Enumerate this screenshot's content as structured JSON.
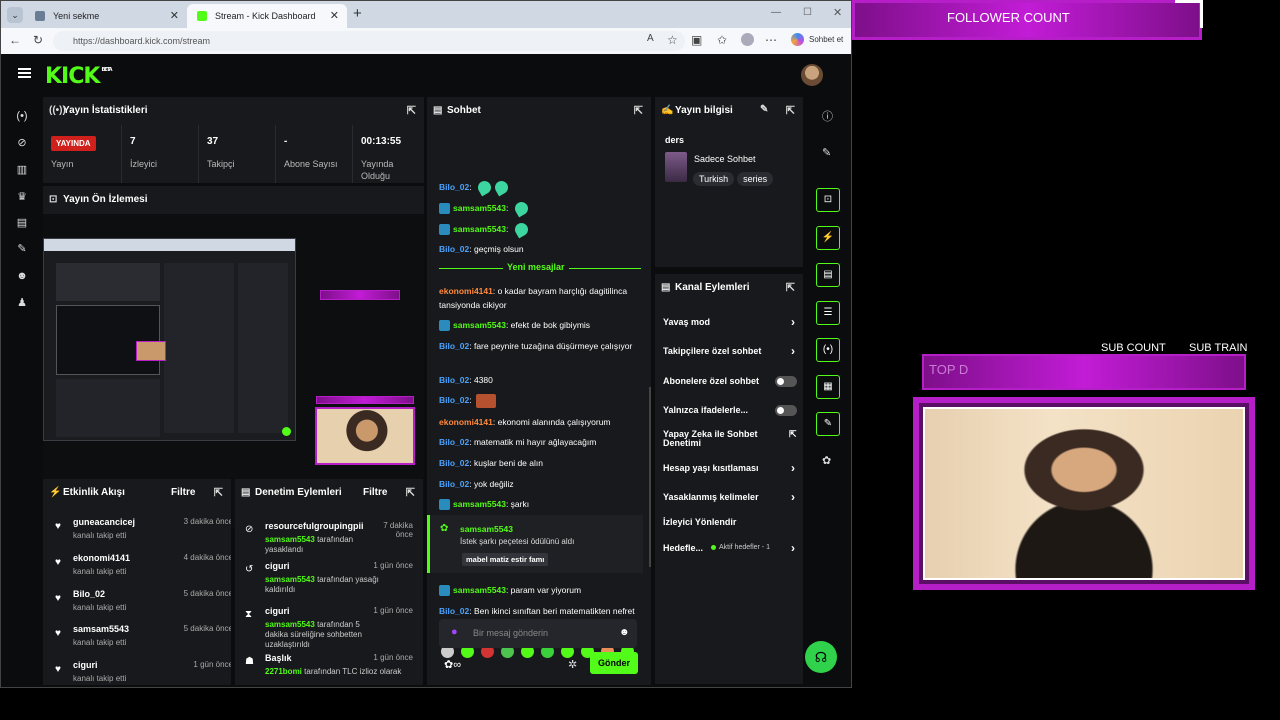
{
  "browser": {
    "tabs": [
      {
        "label": "Yeni sekme",
        "close": "✕"
      },
      {
        "label": "Stream - Kick Dashboard",
        "close": "✕"
      }
    ],
    "new_tab": "+",
    "url": "https://dashboard.kick.com/stream",
    "copilot_label": "Sohbet et"
  },
  "kick": {
    "logo": "KICK",
    "logo_sup": "BETA",
    "stats_panel": {
      "title": "Yayın İstatistikleri",
      "live_badge": "YAYINDA",
      "live_label": "Yayın",
      "viewers_value": "7",
      "viewers_label": "İzleyici",
      "followers_value": "37",
      "followers_label": "Takipçi",
      "subs_value": "-",
      "subs_label": "Abone Sayısı",
      "uptime_value": "00:13:55",
      "uptime_label": "Yayında Olduğu"
    },
    "preview_panel": {
      "title": "Yayın Ön İzlemesi"
    },
    "chat_panel": {
      "title": "Sohbet",
      "new_messages": "Yeni mesajlar",
      "input_placeholder": "Bir mesaj gönderin",
      "send_label": "Gönder",
      "messages": [
        {
          "user": "Bilo_02",
          "text": ": "
        },
        {
          "user": "samsam5543",
          "text": ": "
        },
        {
          "user": "samsam5543",
          "text": ": "
        },
        {
          "user": "Bilo_02",
          "text": ": geçmiş olsun"
        },
        {
          "user": "ekonomi4141",
          "text": ": o kadar bayram harçlığı dagitilincа tansiyonda cikiyor"
        },
        {
          "user": "samsam5543",
          "text": ": efekt de bok gibiymis"
        },
        {
          "user": "Bilo_02",
          "text": ": fare peynire tuzağına düşürmeye çalışıyor"
        },
        {
          "user": "Bilo_02",
          "text": ": 4380"
        },
        {
          "user": "Bilo_02",
          "text": ": "
        },
        {
          "user": "ekonomi4141",
          "text": ": ekonomi alanında çalışıyorum"
        },
        {
          "user": "Bilo_02",
          "text": ": matematik mi hayır ağlayacağım"
        },
        {
          "user": "Bilo_02",
          "text": ": kuşlar beni de alın"
        },
        {
          "user": "Bilo_02",
          "text": ": yok değiliz"
        },
        {
          "user": "samsam5543",
          "text": ": şarkı"
        },
        {
          "user": "samsam5543",
          "text": ": param var yiyorum"
        },
        {
          "user": "Bilo_02",
          "text": ": Ben ikinci sınıftan beri matematikten nefret ediyorum"
        }
      ],
      "reward": {
        "user": "samsam5543",
        "text": "İstek şarkı peçetesi ödülünü aldı",
        "song": "mabel matiz estir famı"
      }
    },
    "stream_info": {
      "title": "Yayın bilgisi",
      "stream_title": "ders",
      "category": "Sadece Sohbet",
      "tags": [
        "Turkish",
        "series"
      ]
    },
    "channel_actions": {
      "title": "Kanal Eylemleri",
      "items": [
        "Yavaş mod",
        "Takipçilere özel sohbet",
        "Abonelere özel sohbet",
        "Yalnızca ifadelerle...",
        "Yapay Zeka ile Sohbet Denetimi",
        "Hesap yaşı kısıtlaması",
        "Yasaklanmış kelimeler",
        "İzleyici Yönlendir",
        "Hedefle..."
      ],
      "goals_status": "Aktif hedefler - 1"
    },
    "activity_feed": {
      "title": "Etkinlik Akışı",
      "filter": "Filtre",
      "items": [
        {
          "name": "guneacancicej",
          "action": "kanalı takip etti",
          "time": "3 dakika önce"
        },
        {
          "name": "ekonomi4141",
          "action": "kanalı takip etti",
          "time": "4 dakika önce"
        },
        {
          "name": "Bilo_02",
          "action": "kanalı takip etti",
          "time": "5 dakika önce"
        },
        {
          "name": "samsam5543",
          "action": "kanalı takip etti",
          "time": "5 dakika önce"
        },
        {
          "name": "ciguri",
          "action": "kanalı takip etti",
          "time": "1 gün önce"
        }
      ]
    },
    "mod_actions": {
      "title": "Denetim Eylemleri",
      "filter": "Filtre",
      "items": [
        {
          "name": "resourcefulgroupingpii",
          "by": "samsam5543",
          "action": "tarafından yasaklandı",
          "time": "7 dakika önce"
        },
        {
          "name": "ciguri",
          "by": "samsam5543",
          "action": "tarafından yasağı kaldırıldı",
          "time": "1 gün önce"
        },
        {
          "name": "ciguri",
          "by": "samsam5543",
          "action": "tarafından 5 dakika süreliğine sohbetten uzaklaştırıldı",
          "time": "1 gün önce"
        },
        {
          "name": "Başlık",
          "by": "2271bomi",
          "action": "tarafından TLC izlioz olarak",
          "time": "1 gün önce"
        }
      ]
    }
  },
  "overlay": {
    "follower_count": "FOLLOWER COUNT",
    "sub_count": "SUB COUNT",
    "sub_train": "SUB TRAIN",
    "top_label": "TOP D"
  },
  "colors": {
    "kick_green": "#53fc18",
    "live_red": "#d0201b",
    "neon_purple": "#c21cd6"
  }
}
